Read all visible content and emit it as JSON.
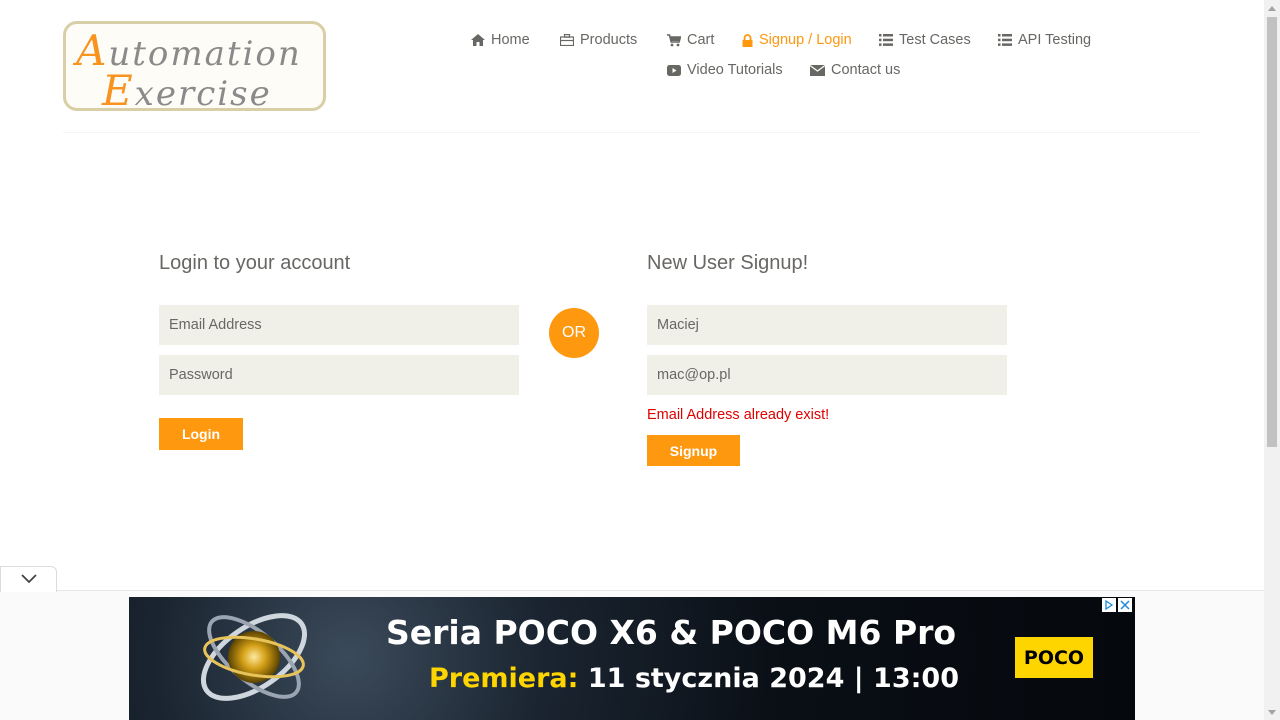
{
  "logo": {
    "line1_cap": "A",
    "line1_rest": "utomation",
    "line2_cap": "E",
    "line2_rest": "xercise"
  },
  "nav": {
    "home": "Home",
    "products": "Products",
    "cart": "Cart",
    "signup_login": "Signup / Login",
    "test_cases": "Test Cases",
    "api_testing": "API Testing",
    "video_tutorials": "Video Tutorials",
    "contact_us": "Contact us",
    "active_color": "#fe980f"
  },
  "login": {
    "title": "Login to your account",
    "email_placeholder": "Email Address",
    "password_placeholder": "Password",
    "button": "Login"
  },
  "or_label": "OR",
  "signup": {
    "title": "New User Signup!",
    "name_value": "Maciej",
    "email_value": "mac@op.pl",
    "error": "Email Address already exist!",
    "button": "Signup"
  },
  "ad": {
    "headline": "Seria POCO X6 & POCO M6 Pro",
    "sub_highlight": "Premiera:",
    "sub_rest": "11 stycznia 2024 | 13:00",
    "brand": "POCO"
  },
  "colors": {
    "accent": "#fe980f",
    "field_bg": "#f0f0e9",
    "error": "#e00000",
    "text": "#696763"
  }
}
